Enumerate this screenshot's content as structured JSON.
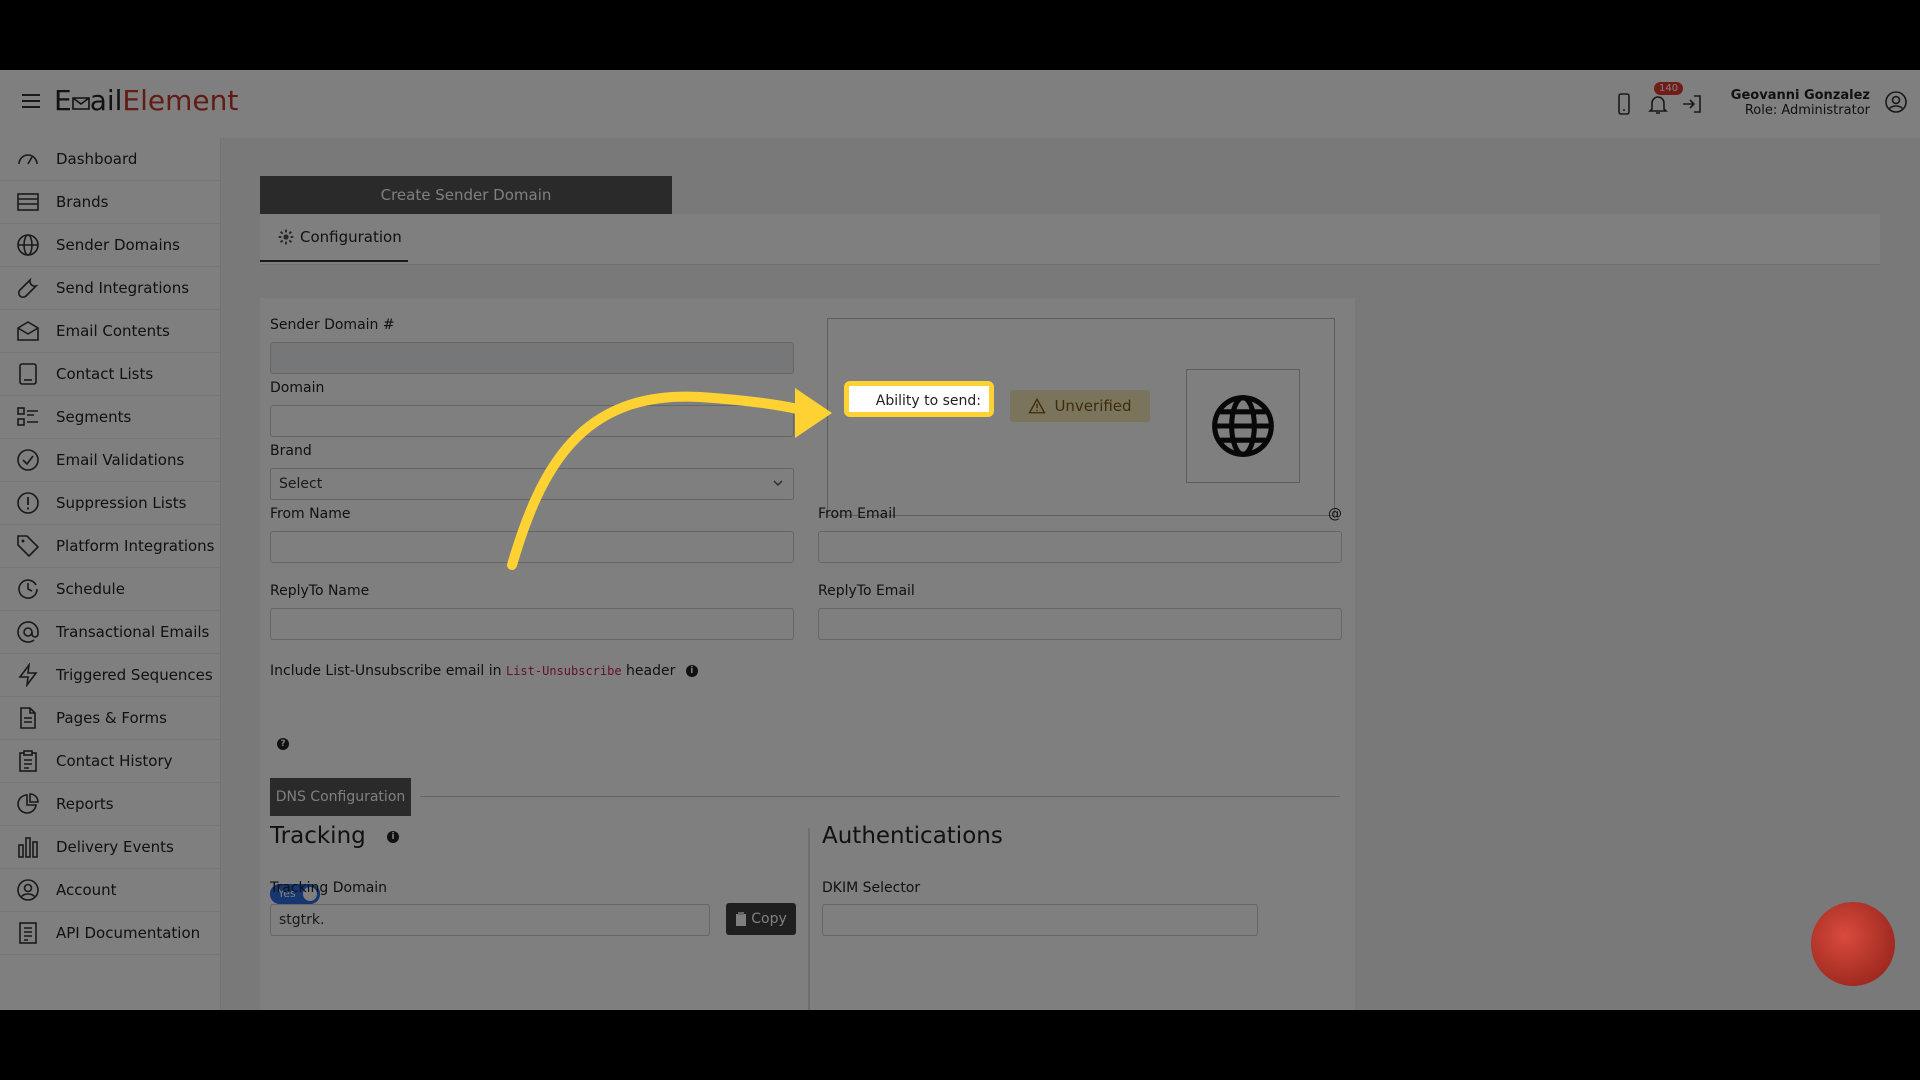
{
  "header": {
    "logo_part1": "E",
    "logo_part2": "ail",
    "logo_part3": "Element",
    "notification_count": "140",
    "user_name": "Geovanni Gonzalez",
    "user_role": "Role: Administrator"
  },
  "sidebar": {
    "items": [
      {
        "label": "Dashboard",
        "icon": "dashboard-icon"
      },
      {
        "label": "Brands",
        "icon": "brands-icon"
      },
      {
        "label": "Sender Domains",
        "icon": "globe-icon"
      },
      {
        "label": "Send Integrations",
        "icon": "wrench-icon"
      },
      {
        "label": "Email Contents",
        "icon": "envelope-icon"
      },
      {
        "label": "Contact Lists",
        "icon": "contact-book-icon"
      },
      {
        "label": "Segments",
        "icon": "segments-icon"
      },
      {
        "label": "Email Validations",
        "icon": "check-circle-icon"
      },
      {
        "label": "Suppression Lists",
        "icon": "exclamation-circle-icon"
      },
      {
        "label": "Platform Integrations",
        "icon": "tag-icon"
      },
      {
        "label": "Schedule",
        "icon": "clock-icon"
      },
      {
        "label": "Transactional Emails",
        "icon": "at-icon"
      },
      {
        "label": "Triggered Sequences",
        "icon": "lightning-icon"
      },
      {
        "label": "Pages & Forms",
        "icon": "document-icon"
      },
      {
        "label": "Contact History",
        "icon": "clipboard-icon"
      },
      {
        "label": "Reports",
        "icon": "pie-chart-icon"
      },
      {
        "label": "Delivery Events",
        "icon": "bar-chart-icon"
      },
      {
        "label": "Account",
        "icon": "user-circle-icon"
      },
      {
        "label": "API Documentation",
        "icon": "api-doc-icon"
      }
    ]
  },
  "main": {
    "create_tab": "Create Sender Domain",
    "config_tab": "Configuration",
    "form": {
      "sender_domain_label": "Sender Domain #",
      "sender_domain_value": "",
      "domain_label": "Domain",
      "domain_value": "",
      "brand_label": "Brand",
      "brand_value": "Select",
      "from_name_label": "From Name",
      "from_email_label": "From Email",
      "from_email_suffix": "@",
      "replyto_name_label": "ReplyTo Name",
      "replyto_email_label": "ReplyTo Email",
      "unsubscribe_text_before": "Include List-Unsubscribe email in",
      "unsubscribe_code": "List-Unsubscribe",
      "unsubscribe_text_after": "header",
      "toggle_label": "Yes",
      "dns_button": "DNS Configuration",
      "tracking_title": "Tracking",
      "tracking_domain_label": "Tracking Domain",
      "tracking_domain_value": "stgtrk.",
      "copy_button": "Copy",
      "auth_title": "Authentications",
      "dkim_label": "DKIM Selector",
      "dkim_value": ""
    },
    "status": {
      "ability_label": "Ability to send:",
      "unverified_label": "Unverified"
    }
  },
  "colors": {
    "highlight": "#ffd233",
    "brand_red": "#c0392b",
    "toggle_blue": "#2d6cdf",
    "unverified_bg": "#f7e8b8"
  }
}
